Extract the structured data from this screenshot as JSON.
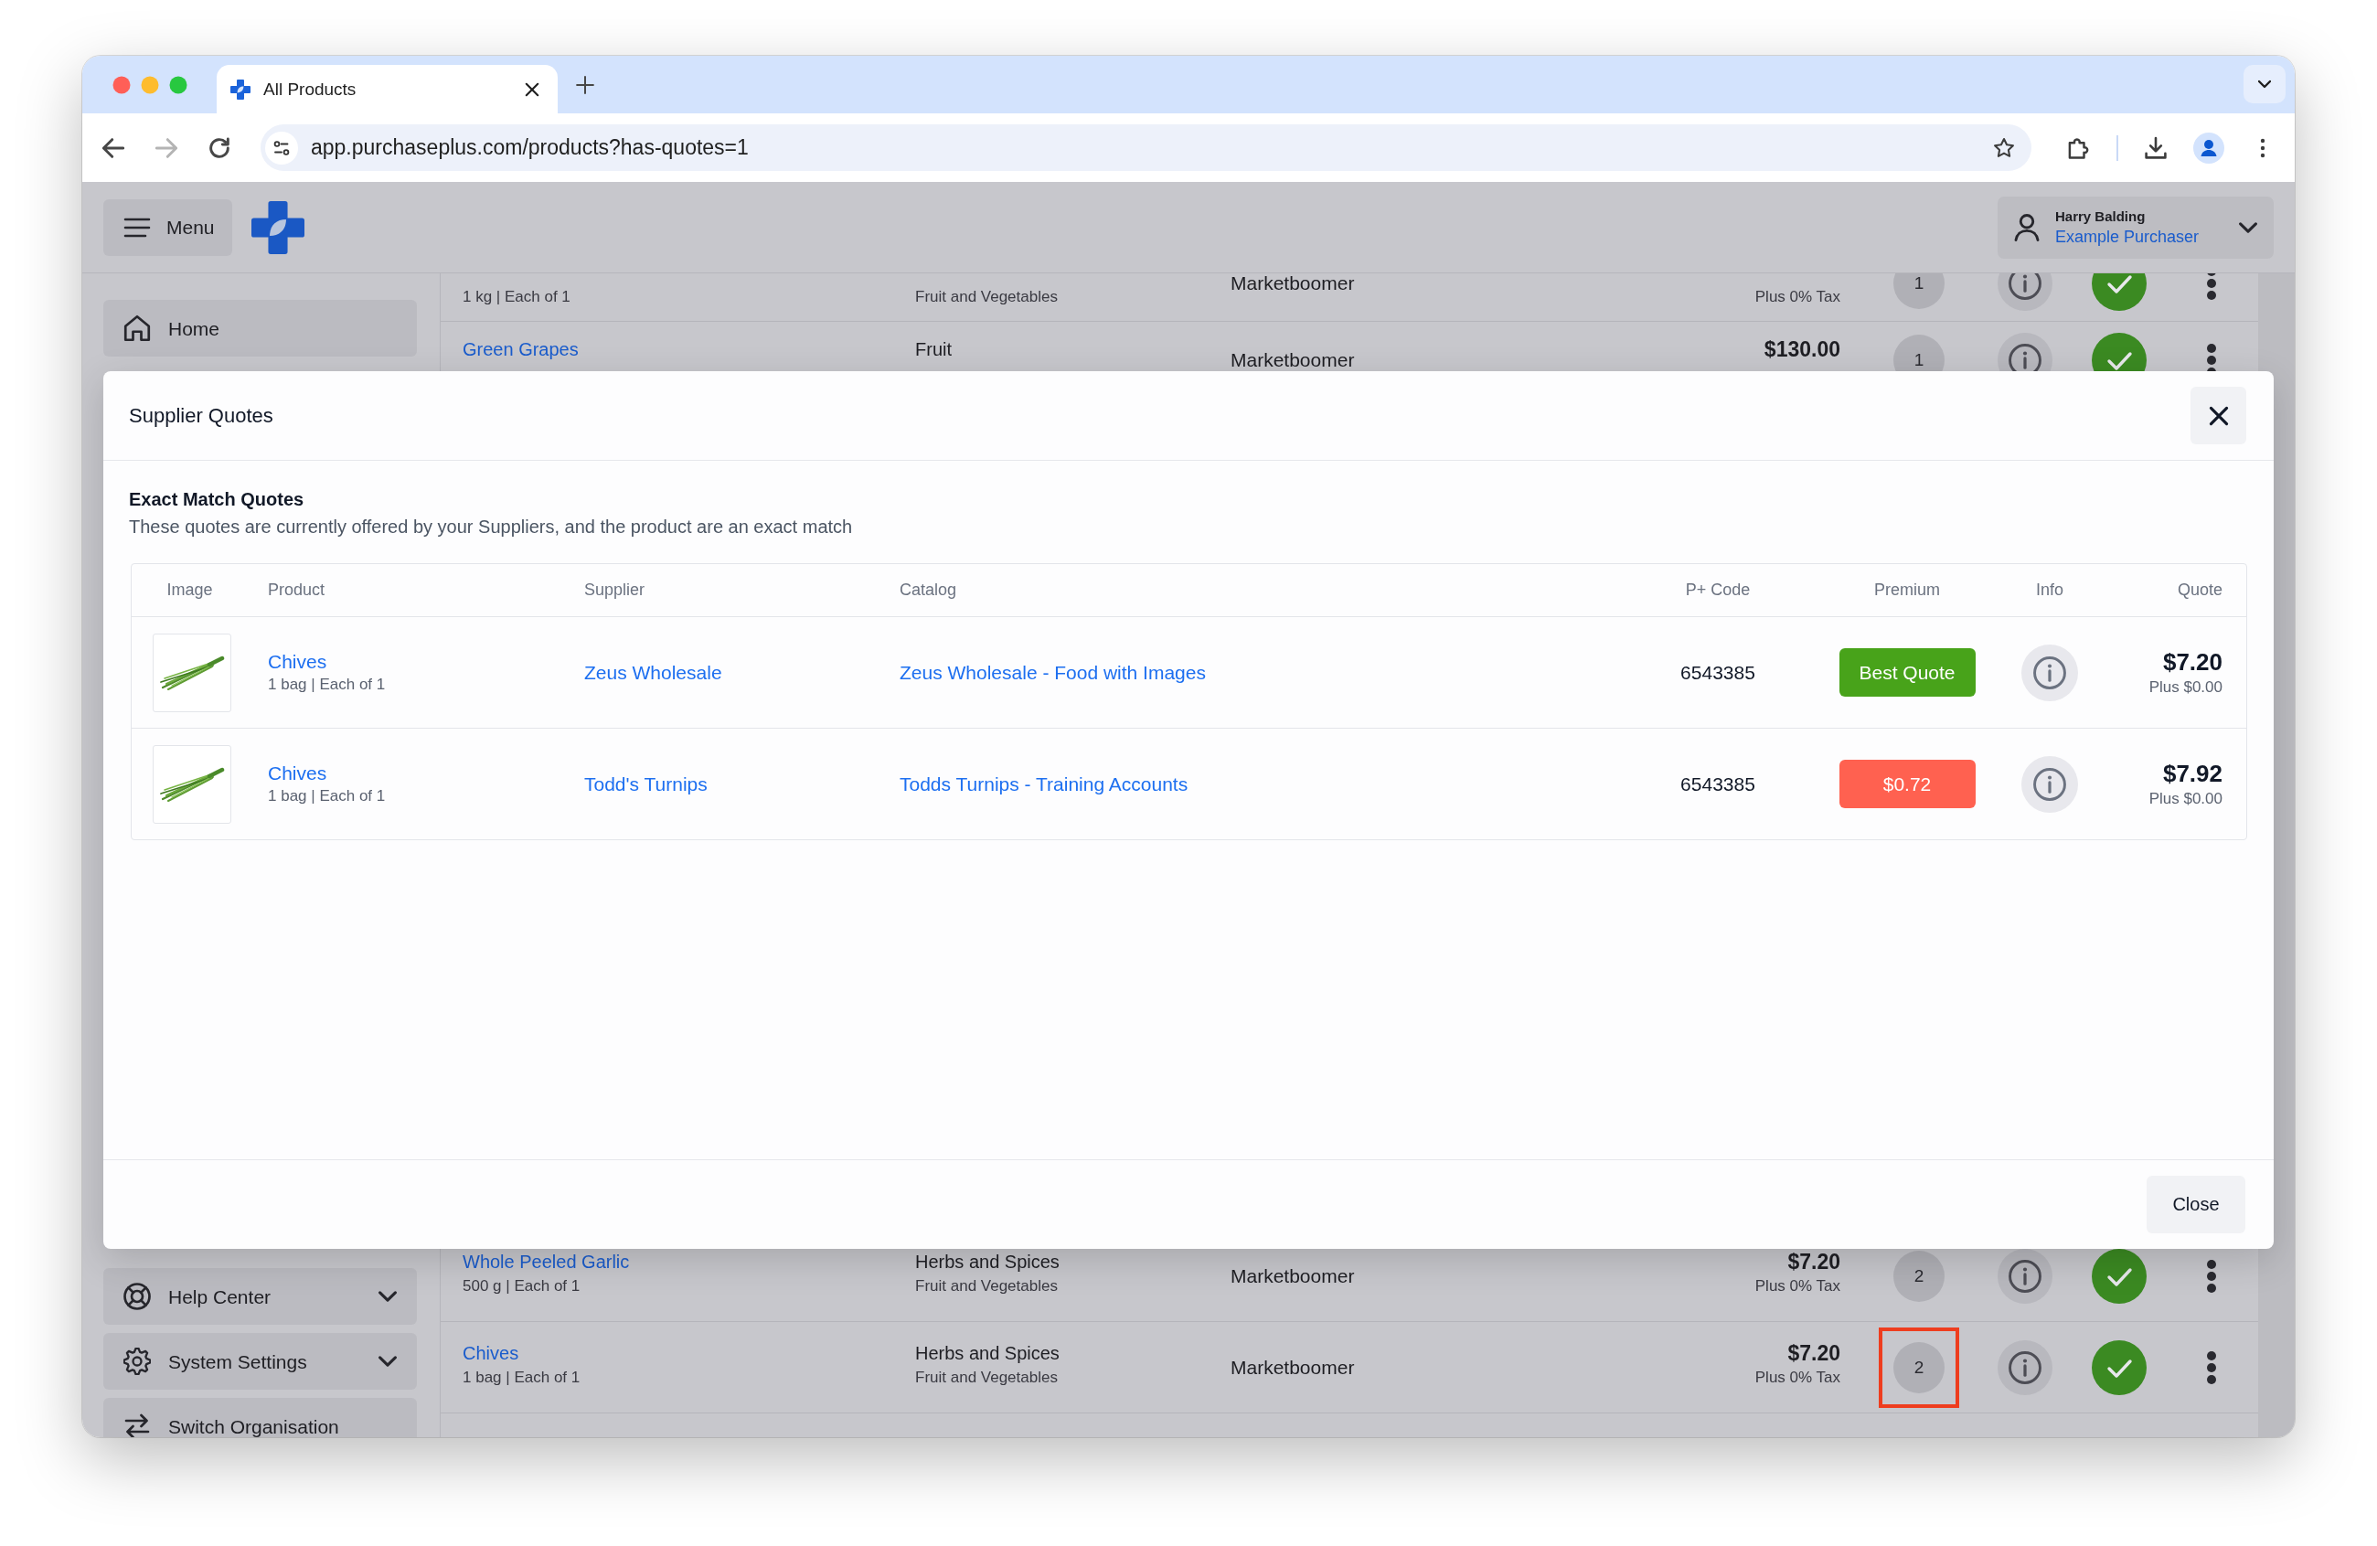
{
  "browser": {
    "tab": {
      "title": "All Products"
    },
    "address": "app.purchaseplus.com/products?has-quotes=1"
  },
  "app_header": {
    "menu_label": "Menu",
    "user": {
      "name": "Harry Balding",
      "role": "Example Purchaser"
    }
  },
  "sidebar": {
    "top_items": [
      {
        "label": "Home",
        "expandable": false
      }
    ],
    "bottom_items": [
      {
        "label": "Help Center",
        "expandable": true
      },
      {
        "label": "System Settings",
        "expandable": true
      },
      {
        "label": "Switch Organisation",
        "expandable": false
      }
    ]
  },
  "products": {
    "upper_rows": [
      {
        "unit": "1 kg | Each of 1",
        "subcategory": "Fruit and Vegetables",
        "supplier": "Marketboomer",
        "tax": "Plus 0% Tax",
        "quote_count": "1",
        "approved": true,
        "highlighted": false
      },
      {
        "name": "Green Grapes",
        "category": "Fruit",
        "supplier": "Marketboomer",
        "price": "$130.00",
        "quote_count": "1",
        "approved": true,
        "highlighted": false
      }
    ],
    "lower_rows": [
      {
        "name": "Whole Peeled Garlic",
        "unit": "500 g | Each of 1",
        "category": "Herbs and Spices",
        "subcategory": "Fruit and Vegetables",
        "supplier": "Marketboomer",
        "price": "$7.20",
        "tax": "Plus 0% Tax",
        "quote_count": "2",
        "approved": true,
        "highlighted": false
      },
      {
        "name": "Chives",
        "unit": "1 bag | Each of 1",
        "category": "Herbs and Spices",
        "subcategory": "Fruit and Vegetables",
        "supplier": "Marketboomer",
        "price": "$7.20",
        "tax": "Plus 0% Tax",
        "quote_count": "2",
        "approved": true,
        "highlighted": true
      }
    ]
  },
  "quotes_dialog": {
    "title": "Supplier Quotes",
    "section": {
      "title": "Exact Match Quotes",
      "description": "These quotes are currently offered by your Suppliers, and the product are an exact match"
    },
    "table": {
      "columns": [
        "Image",
        "Product",
        "Supplier",
        "Catalog",
        "P+ Code",
        "Premium",
        "Info",
        "Quote"
      ],
      "rows": [
        {
          "product": "Chives",
          "unit": "1 bag | Each of 1",
          "supplier": "Zeus Wholesale",
          "catalog": "Zeus Wholesale - Food with Images",
          "code": "6543385",
          "premium": {
            "kind": "best",
            "label": "Best Quote"
          },
          "price": "$7.20",
          "tax": "Plus $0.00"
        },
        {
          "product": "Chives",
          "unit": "1 bag | Each of 1",
          "supplier": "Todd's Turnips",
          "catalog": "Todds Turnips - Training Accounts",
          "code": "6543385",
          "premium": {
            "kind": "extra",
            "label": "$0.72"
          },
          "price": "$7.92",
          "tax": "Plus $0.00"
        }
      ]
    },
    "close_button": "Close"
  }
}
